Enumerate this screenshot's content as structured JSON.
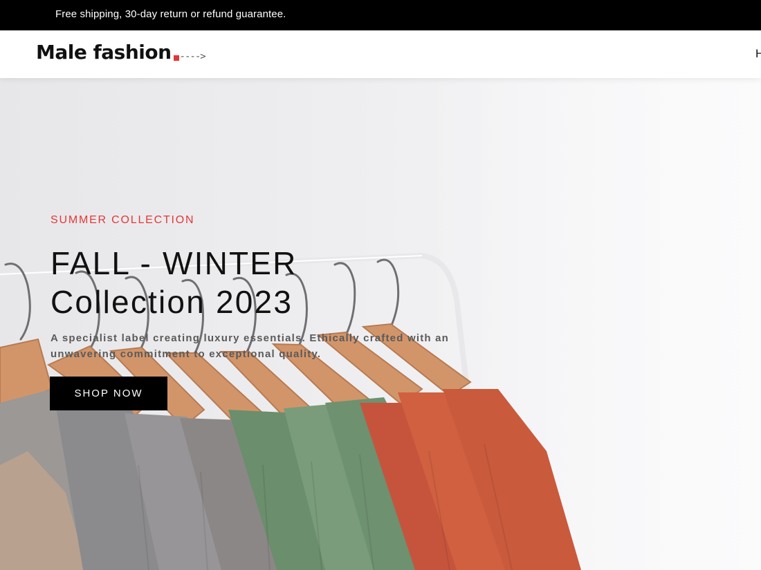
{
  "topbar": {
    "text": "Free shipping, 30-day return or refund guarantee."
  },
  "header": {
    "logo": {
      "text": "Male fashion",
      "arrow": "---->"
    },
    "nav_partial": "H"
  },
  "hero": {
    "subtitle": "SUMMER COLLECTION",
    "title_line1": "FALL - WINTER",
    "title_line2": "Collection 2023",
    "description": "A specialist label creating luxury essentials. Ethically crafted with an unwavering commitment to exceptional quality.",
    "button_label": "SHOP NOW"
  },
  "colors": {
    "accent": "#e53637",
    "dark": "#000000"
  }
}
